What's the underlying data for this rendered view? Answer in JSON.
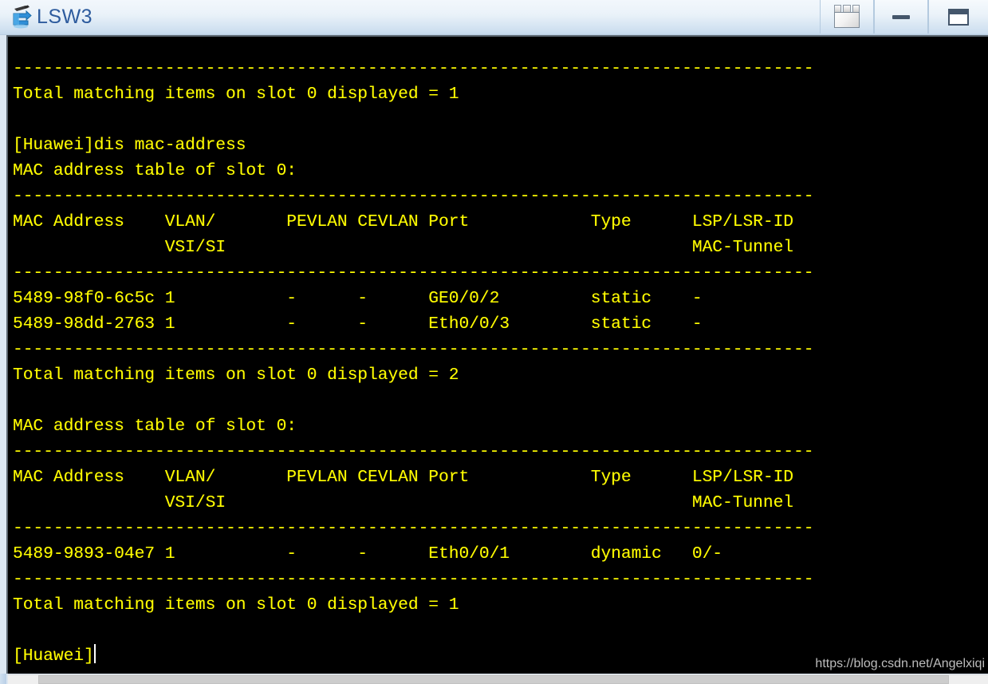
{
  "window": {
    "title": "LSW3",
    "icon": "switch-device-icon",
    "title_color": "#2e5c9e",
    "buttons": [
      {
        "name": "toolbar-windows-button",
        "icon": "windows-stack-icon",
        "label": ""
      },
      {
        "name": "minimize-button",
        "icon": "minimize-icon",
        "label": ""
      },
      {
        "name": "maximize-button",
        "icon": "maximize-icon",
        "label": ""
      }
    ]
  },
  "terminal": {
    "foreground_color": "#ffff00",
    "background_color": "#000000",
    "cursor_visible": true,
    "prompt": "[Huawei]",
    "lines": [
      "-------------------------------------------------------------------------------",
      "Total matching items on slot 0 displayed = 1",
      "",
      "[Huawei]dis mac-address",
      "MAC address table of slot 0:",
      "-------------------------------------------------------------------------------",
      "MAC Address    VLAN/       PEVLAN CEVLAN Port            Type      LSP/LSR-ID",
      "               VSI/SI                                              MAC-Tunnel",
      "-------------------------------------------------------------------------------",
      "5489-98f0-6c5c 1           -      -      GE0/0/2         static    -",
      "5489-98dd-2763 1           -      -      Eth0/0/3        static    -",
      "-------------------------------------------------------------------------------",
      "Total matching items on slot 0 displayed = 2",
      "",
      "MAC address table of slot 0:",
      "-------------------------------------------------------------------------------",
      "MAC Address    VLAN/       PEVLAN CEVLAN Port            Type      LSP/LSR-ID",
      "               VSI/SI                                              MAC-Tunnel",
      "-------------------------------------------------------------------------------",
      "5489-9893-04e7 1           -      -      Eth0/0/1        dynamic   0/-",
      "-------------------------------------------------------------------------------",
      "Total matching items on slot 0 displayed = 1",
      "",
      "[Huawei]"
    ],
    "command_entered": "dis mac-address",
    "mac_table_header": {
      "columns": [
        "MAC Address",
        "VLAN/ VSI/SI",
        "PEVLAN",
        "CEVLAN",
        "Port",
        "Type",
        "LSP/LSR-ID MAC-Tunnel"
      ]
    },
    "mac_table_1": {
      "slot": "0",
      "rows": [
        {
          "mac": "5489-98f0-6c5c",
          "vlan": "1",
          "pevlan": "-",
          "cevlan": "-",
          "port": "GE0/0/2",
          "type": "static",
          "lsp": "-"
        },
        {
          "mac": "5489-98dd-2763",
          "vlan": "1",
          "pevlan": "-",
          "cevlan": "-",
          "port": "Eth0/0/3",
          "type": "static",
          "lsp": "-"
        }
      ],
      "total_displayed": "2"
    },
    "mac_table_2": {
      "slot": "0",
      "rows": [
        {
          "mac": "5489-9893-04e7",
          "vlan": "1",
          "pevlan": "-",
          "cevlan": "-",
          "port": "Eth0/0/1",
          "type": "dynamic",
          "lsp": "0/-"
        }
      ],
      "total_displayed": "1"
    }
  },
  "watermark": {
    "text": "https://blog.csdn.net/Angelxiqi"
  },
  "scrollbar": {
    "orientation": "horizontal"
  }
}
